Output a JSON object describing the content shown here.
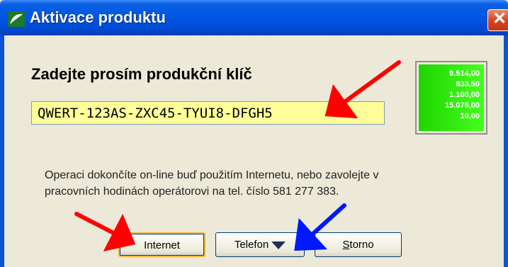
{
  "window": {
    "title": "Aktivace produktu",
    "close_glyph": "✕"
  },
  "main": {
    "heading": "Zadejte prosím produkční klíč",
    "product_key": "QWERT-123AS-ZXC45-TYUI8-DFGH5",
    "numbers": [
      "9.514,00",
      "833,50",
      "1.100,00",
      "15.076,00",
      "10,00"
    ],
    "info_line1": "Operaci dokončíte on-line buď použitím Internetu, nebo zavolejte v",
    "info_line2": "pracovních hodinách operátorovi na tel. číslo 581 277 383."
  },
  "buttons": {
    "internet": "Internet",
    "telefon": "Telefon",
    "storno_first": "S",
    "storno_rest": "torno"
  },
  "annotations": {
    "red_arrow_color": "#ff0000",
    "blue_arrow_color": "#0018ff"
  }
}
